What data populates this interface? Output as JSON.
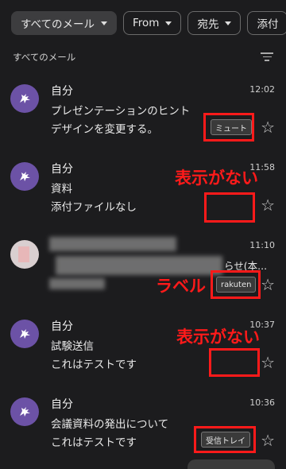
{
  "chips": [
    "すべてのメール",
    "From",
    "宛先",
    "添付"
  ],
  "section_title": "すべてのメール",
  "emails": [
    {
      "sender": "自分",
      "time": "12:02",
      "subject": "プレゼンテーションのヒント",
      "snippet": "デザインを変更する。",
      "label": "ミュート",
      "annotation": ""
    },
    {
      "sender": "自分",
      "time": "11:58",
      "subject": "資料",
      "snippet": "添付ファイルなし",
      "label": "",
      "annotation": "表示がない"
    },
    {
      "sender": "",
      "time": "11:10",
      "subject": "らせ(本...",
      "snippet": "",
      "label": "rakuten",
      "annotation": "ラベル"
    },
    {
      "sender": "自分",
      "time": "10:37",
      "subject": "試験送信",
      "snippet": "これはテストです",
      "label": "",
      "annotation": "表示がない"
    },
    {
      "sender": "自分",
      "time": "10:36",
      "subject": "会議資料の発出について",
      "snippet": "これはテストです",
      "label": "受信トレイ",
      "annotation": ""
    }
  ],
  "colors": {
    "background": "#1c1c1e",
    "avatar": "#6c52a6",
    "annotation": "#ff1a1a"
  },
  "icons": {
    "filter": "filter-icon",
    "star": "star-outline-icon",
    "avatar": "pegasus-avatar-icon"
  }
}
